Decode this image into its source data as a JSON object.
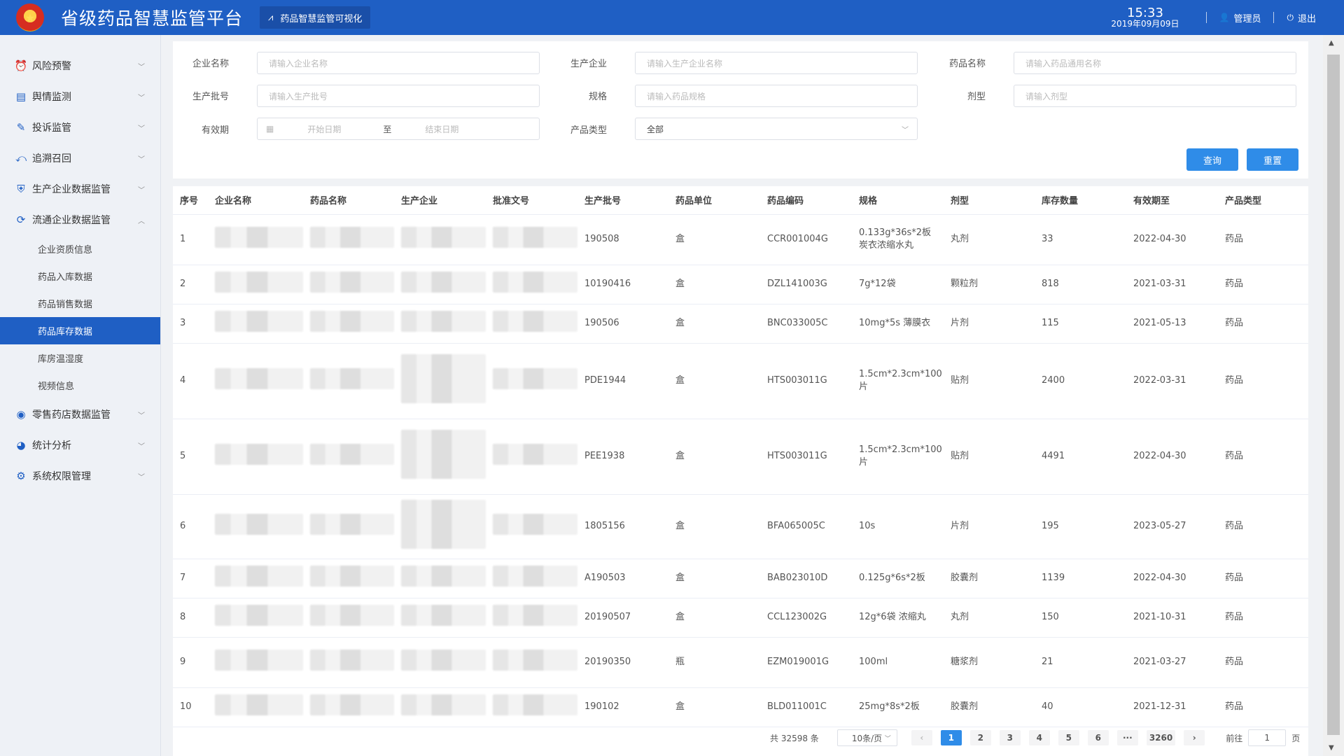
{
  "header": {
    "title": "省级药品智慧监管平台",
    "viz_link": "药品智慧监管可视化",
    "time": "15:33",
    "date": "2019年09月09日",
    "user": "管理员",
    "logout": "退出"
  },
  "sidebar": {
    "items": [
      {
        "label": "风险预警",
        "icon": "alarm-icon",
        "glyph": "⏰",
        "chev": "﹀"
      },
      {
        "label": "舆情监测",
        "icon": "news-icon",
        "glyph": "▤",
        "chev": "﹀"
      },
      {
        "label": "投诉监管",
        "icon": "complaint-icon",
        "glyph": "✎",
        "chev": "﹀"
      },
      {
        "label": "追溯召回",
        "icon": "trace-icon",
        "glyph": "⤺",
        "chev": "﹀"
      },
      {
        "label": "生产企业数据监管",
        "icon": "shield-icon",
        "glyph": "⛨",
        "chev": "﹀"
      },
      {
        "label": "流通企业数据监管",
        "icon": "cycle-icon",
        "glyph": "⟳",
        "chev": "︿"
      }
    ],
    "sub_items": [
      "企业资质信息",
      "药品入库数据",
      "药品销售数据",
      "药品库存数据",
      "库房温湿度",
      "视频信息"
    ],
    "items_after": [
      {
        "label": "零售药店数据监管",
        "icon": "eye-icon",
        "glyph": "◉",
        "chev": "﹀"
      },
      {
        "label": "统计分析",
        "icon": "chart-icon",
        "glyph": "◕",
        "chev": "﹀"
      },
      {
        "label": "系统权限管理",
        "icon": "gear-icon",
        "glyph": "⚙",
        "chev": "﹀"
      }
    ]
  },
  "filters": {
    "company_label": "企业名称",
    "company_ph": "请输入企业名称",
    "producer_label": "生产企业",
    "producer_ph": "请输入生产企业名称",
    "drug_label": "药品名称",
    "drug_ph": "请输入药品通用名称",
    "batch_label": "生产批号",
    "batch_ph": "请输入生产批号",
    "spec_label": "规格",
    "spec_ph": "请输入药品规格",
    "form_label": "剂型",
    "form_ph": "请输入剂型",
    "expiry_label": "有效期",
    "start_ph": "开始日期",
    "to": "至",
    "end_ph": "结束日期",
    "type_label": "产品类型",
    "type_value": "全部",
    "query_btn": "查询",
    "reset_btn": "重置"
  },
  "table": {
    "columns": [
      "序号",
      "企业名称",
      "药品名称",
      "生产企业",
      "批准文号",
      "生产批号",
      "药品单位",
      "药品编码",
      "规格",
      "剂型",
      "库存数量",
      "有效期至",
      "产品类型"
    ],
    "rows": [
      {
        "no": "1",
        "batch": "190508",
        "unit": "盒",
        "code": "CCR001004G",
        "spec": "0.133g*36s*2板 炭衣浓缩水丸",
        "form": "丸剂",
        "qty": "33",
        "expiry": "2022-04-30",
        "type": "药品"
      },
      {
        "no": "2",
        "batch": "10190416",
        "unit": "盒",
        "code": "DZL141003G",
        "spec": "7g*12袋",
        "form": "颗粒剂",
        "qty": "818",
        "expiry": "2021-03-31",
        "type": "药品"
      },
      {
        "no": "3",
        "batch": "190506",
        "unit": "盒",
        "code": "BNC033005C",
        "spec": "10mg*5s 薄膜衣",
        "form": "片剂",
        "qty": "115",
        "expiry": "2021-05-13",
        "type": "药品"
      },
      {
        "no": "4",
        "batch": "PDE1944",
        "unit": "盒",
        "code": "HTS003011G",
        "spec": "1.5cm*2.3cm*100片",
        "form": "贴剂",
        "qty": "2400",
        "expiry": "2022-03-31",
        "type": "药品"
      },
      {
        "no": "5",
        "batch": "PEE1938",
        "unit": "盒",
        "code": "HTS003011G",
        "spec": "1.5cm*2.3cm*100片",
        "form": "贴剂",
        "qty": "4491",
        "expiry": "2022-04-30",
        "type": "药品"
      },
      {
        "no": "6",
        "batch": "1805156",
        "unit": "盒",
        "code": "BFA065005C",
        "spec": "10s",
        "form": "片剂",
        "qty": "195",
        "expiry": "2023-05-27",
        "type": "药品"
      },
      {
        "no": "7",
        "batch": "A190503",
        "unit": "盒",
        "code": "BAB023010D",
        "spec": "0.125g*6s*2板",
        "form": "胶囊剂",
        "qty": "1139",
        "expiry": "2022-04-30",
        "type": "药品"
      },
      {
        "no": "8",
        "batch": "20190507",
        "unit": "盒",
        "code": "CCL123002G",
        "spec": "12g*6袋 浓缩丸",
        "form": "丸剂",
        "qty": "150",
        "expiry": "2021-10-31",
        "type": "药品"
      },
      {
        "no": "9",
        "batch": "20190350",
        "unit": "瓶",
        "code": "EZM019001G",
        "spec": "100ml",
        "form": "糖浆剂",
        "qty": "21",
        "expiry": "2021-03-27",
        "type": "药品"
      },
      {
        "no": "10",
        "batch": "190102",
        "unit": "盒",
        "code": "BLD011001C",
        "spec": "25mg*8s*2板",
        "form": "胶囊剂",
        "qty": "40",
        "expiry": "2021-12-31",
        "type": "药品"
      }
    ]
  },
  "pagination": {
    "total": "共 32598 条",
    "page_size": "10条/页",
    "prev": "‹",
    "pages": [
      "1",
      "2",
      "3",
      "4",
      "5",
      "6",
      "···",
      "3260"
    ],
    "next": "›",
    "goto_prefix": "前往",
    "goto_value": "1",
    "goto_suffix": "页"
  }
}
